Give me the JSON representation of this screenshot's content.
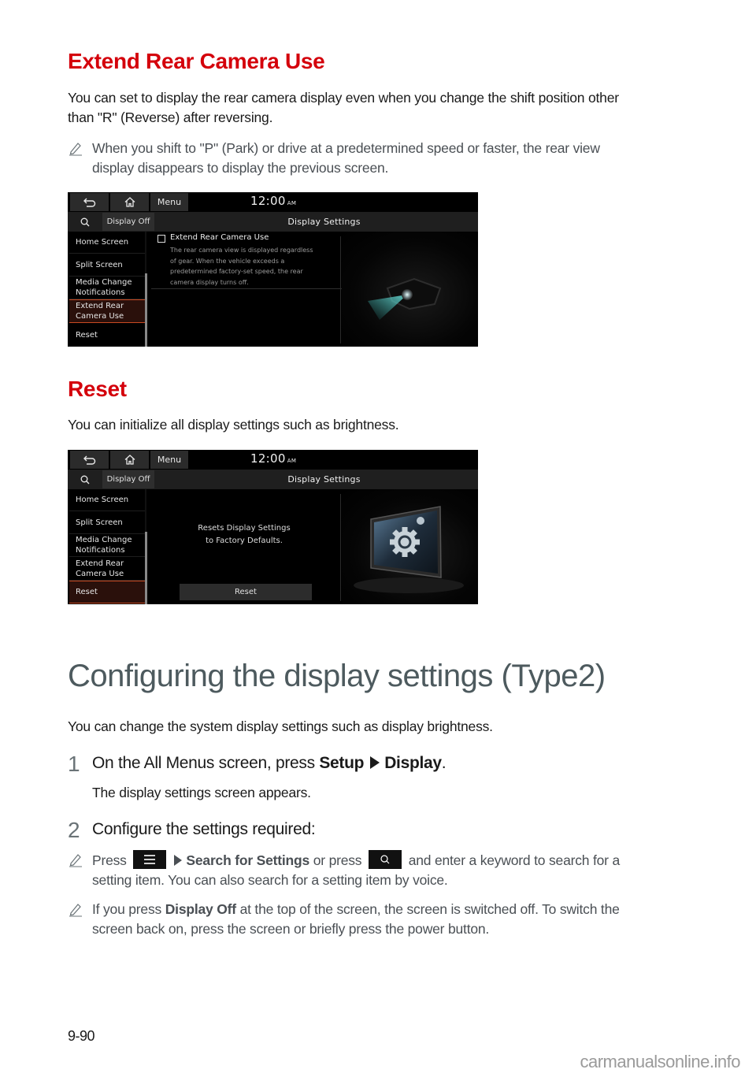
{
  "section1": {
    "heading": "Extend Rear Camera Use",
    "body_line1": "You can set to display the rear camera display even when you change the shift position other",
    "body_line2": "than \"R\" (Reverse) after reversing.",
    "note_line1": "When you shift to \"P\" (Park) or drive at a predetermined speed or faster, the rear view",
    "note_line2": "display disappears to display the previous screen.",
    "note_icon": "pencil-icon"
  },
  "screen1": {
    "back_icon": "back-arrow-icon",
    "home_icon": "home-icon",
    "menu_label": "Menu",
    "clock_time": "12:00",
    "clock_ampm": "AM",
    "search_icon": "search-icon",
    "display_off_label": "Display Off",
    "title": "Display Settings",
    "sidebar": [
      {
        "line1": "Home Screen",
        "line2": ""
      },
      {
        "line1": "Split Screen",
        "line2": ""
      },
      {
        "line1": "Media Change",
        "line2": "Notifications"
      },
      {
        "line1": "Extend Rear",
        "line2": "Camera Use"
      },
      {
        "line1": "Reset",
        "line2": ""
      }
    ],
    "active_item": "Extend Rear Camera Use",
    "option_label": "Extend Rear Camera Use",
    "option_checked": false,
    "option_desc_lines": [
      "The rear camera view is displayed regardless",
      "of gear. When the vehicle exceeds a",
      "predetermined factory-set speed, the rear",
      "camera display turns off."
    ],
    "illustration": "rear-camera-illustration"
  },
  "section2": {
    "heading": "Reset",
    "body": "You can initialize all display settings such as brightness."
  },
  "screen2": {
    "menu_label": "Menu",
    "clock_time": "12:00",
    "clock_ampm": "AM",
    "display_off_label": "Display Off",
    "title": "Display Settings",
    "sidebar": [
      {
        "line1": "Home Screen",
        "line2": ""
      },
      {
        "line1": "Split Screen",
        "line2": ""
      },
      {
        "line1": "Media Change",
        "line2": "Notifications"
      },
      {
        "line1": "Extend Rear",
        "line2": "Camera Use"
      },
      {
        "line1": "Reset",
        "line2": ""
      }
    ],
    "active_item": "Reset",
    "message_line1": "Resets Display Settings",
    "message_line2": "to Factory Defaults.",
    "reset_button": "Reset",
    "illustration": "display-gear-illustration"
  },
  "section3": {
    "heading": "Configuring the display settings (Type2)",
    "intro": "You can change the system display settings such as display brightness.",
    "step1": {
      "number": "1",
      "text_prefix": "On the All Menus screen, press ",
      "bold1": "Setup",
      "bold2": "Display",
      "text_suffix": ".",
      "sub": "The display settings screen appears."
    },
    "step2": {
      "number": "2",
      "text": "Configure the settings required:"
    },
    "note1": {
      "prefix": "Press",
      "bold": "Search for Settings",
      "middle": " or press",
      "suffix": " and enter a keyword to search for a",
      "line2": "setting item. You can also search for a setting item by voice.",
      "menu_icon": "hamburger-menu-icon",
      "search_icon": "search-icon"
    },
    "note2": {
      "prefix": "If you press ",
      "bold": "Display Off",
      "suffix": " at the top of the screen, the screen is switched off. To switch the",
      "line2": "screen back on, press the screen or briefly press the power button."
    }
  },
  "footer": {
    "page_number": "9-90",
    "watermark": "carmanualsonline.info"
  },
  "colors": {
    "heading_red": "#d4000b",
    "h1_gray": "#4d5a5e",
    "note_gray": "#4a4f54",
    "active_accent": "#c84a22"
  }
}
